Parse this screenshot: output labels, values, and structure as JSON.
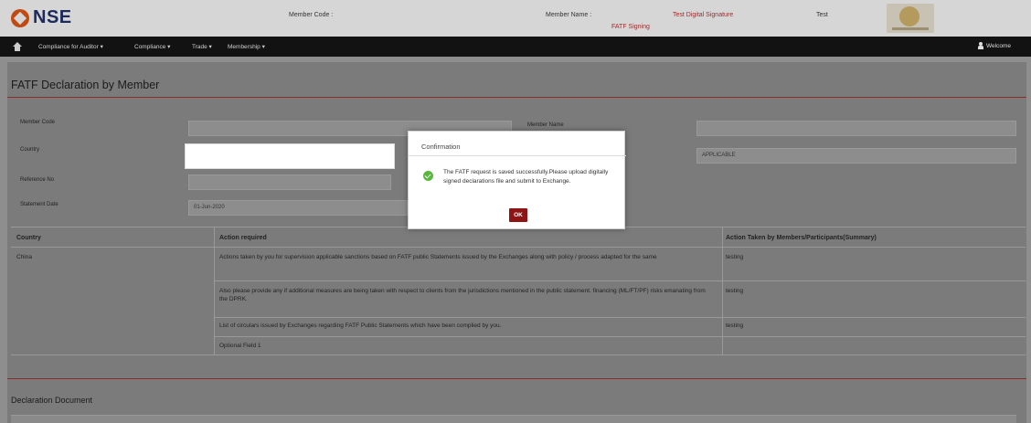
{
  "header": {
    "logo": "NSE",
    "member_code_label": "Member Code :",
    "member_name_label": "Member Name :",
    "fatf_signing": "FATF Signing",
    "test_digital_signature": "Test Digital Signature",
    "test_label": "Test"
  },
  "nav": {
    "items": [
      "Compliance for Auditor",
      "Compliance",
      "Trade",
      "Membership"
    ],
    "welcome": "Welcome"
  },
  "page": {
    "title": "FATF Declaration by Member"
  },
  "form": {
    "member_code_label": "Member Code",
    "member_name_label": "Member Name",
    "country_label": "Country",
    "reference_no_label": "Reference No",
    "statement_date_label": "Statement Date",
    "statement_date_value": "01-Jun-2020",
    "applicable_value": "APPLICABLE"
  },
  "table": {
    "headers": [
      "Country",
      "Action required",
      "Action Taken by Members/Participants(Summary)"
    ],
    "country_value": "China",
    "rows": [
      {
        "action": "Actions taken by you for supervision applicable sanctions based on FATF public Statements issued by the Exchanges along with policy / process adapted for the same",
        "taken": "testing"
      },
      {
        "action": "Also please provide any if additional measures are being taken with respect to clients from the jurisdictions mentioned in the public statement. financing (ML/FT/PF) risks emanating from the DPRK.",
        "taken": "testing"
      },
      {
        "action": "List of circulars issued by Exchanges regarding FATF Public Statements which have been complied by you.",
        "taken": "testing"
      },
      {
        "action": "Optional Field 1",
        "taken": ""
      }
    ]
  },
  "declaration": {
    "title": "Declaration Document"
  },
  "dialog": {
    "title": "Confirmation",
    "message": "The FATF request is saved successfully.Please upload digitally signed declarations file and submit to Exchange.",
    "ok_label": "OK"
  }
}
